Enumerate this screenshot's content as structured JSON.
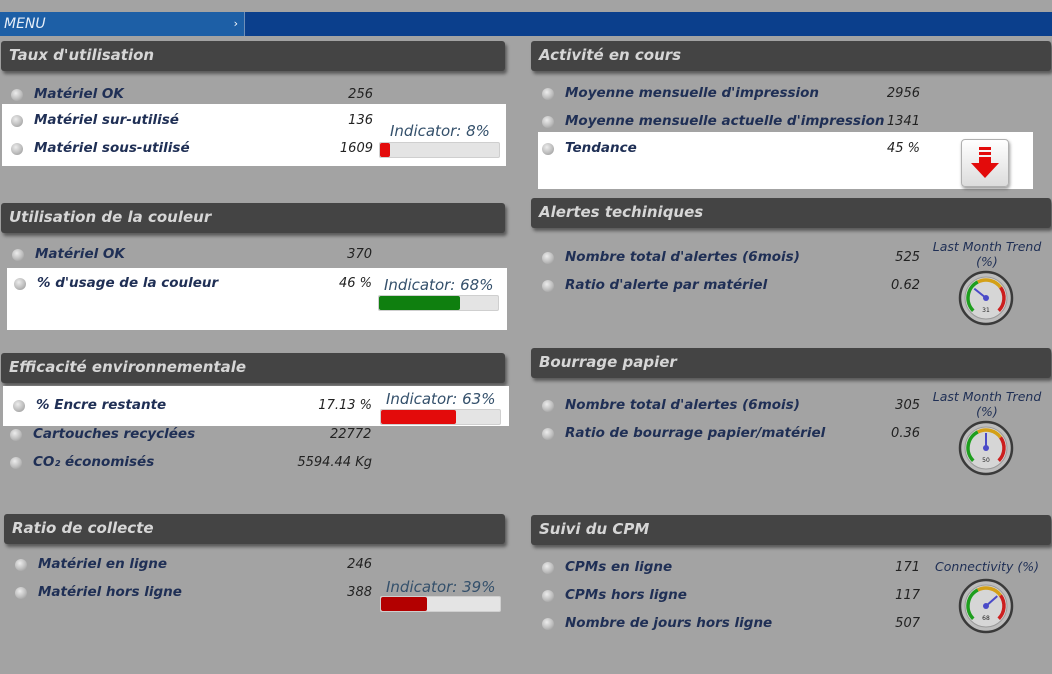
{
  "menu": {
    "label": "MENU"
  },
  "colors": {
    "red": "#e30b0b",
    "green": "#0f7f0f",
    "dark_red": "#b30000",
    "header_bg": "#444444"
  },
  "left": {
    "taux": {
      "title": "Taux d'utilisation",
      "rows": [
        {
          "label": "Matériel OK",
          "value": "256"
        },
        {
          "label": "Matériel sur-utilisé",
          "value": "136"
        },
        {
          "label": "Matériel sous-utilisé",
          "value": "1609"
        }
      ],
      "indicator": {
        "text": "Indicator: 8%",
        "level": 0.08
      }
    },
    "couleur": {
      "title": "Utilisation de la couleur",
      "rows": [
        {
          "label": "Matériel OK",
          "value": "370"
        },
        {
          "label": "% d'usage de la couleur",
          "value": "46 %"
        }
      ],
      "indicator": {
        "text": "Indicator: 68%",
        "level": 0.68
      }
    },
    "env": {
      "title": "Efficacité environnementale",
      "rows": [
        {
          "label": "% Encre restante",
          "value": "17.13 %"
        },
        {
          "label": "Cartouches recyclées",
          "value": "22772"
        },
        {
          "label": "CO₂ économisés",
          "value": "5594.44 Kg"
        }
      ],
      "indicator": {
        "text": "Indicator: 63%",
        "level": 0.63
      }
    },
    "collecte": {
      "title": "Ratio de collecte",
      "rows": [
        {
          "label": "Matériel en ligne",
          "value": "246"
        },
        {
          "label": "Matériel hors ligne",
          "value": "388"
        }
      ],
      "indicator": {
        "text": "Indicator: 39%",
        "level": 0.39
      }
    }
  },
  "right": {
    "activite": {
      "title": "Activité en cours",
      "rows": [
        {
          "label": "Moyenne mensuelle d'impression",
          "value": "2956"
        },
        {
          "label": "Moyenne mensuelle actuelle d'impression",
          "value": "1341"
        },
        {
          "label": "Tendance",
          "value": "45 %"
        }
      ],
      "trend_icon": "red-down-arrow-icon"
    },
    "alertes": {
      "title": "Alertes techiniques",
      "rows": [
        {
          "label": "Nombre total d'alertes (6mois)",
          "value": "525"
        },
        {
          "label": "Ratio d'alerte par matériel",
          "value": "0.62"
        }
      ],
      "trend_title_1": "Last Month Trend",
      "trend_title_2": "(%)",
      "gauge_value": "31",
      "gauge_level": 0.31
    },
    "bourrage": {
      "title": "Bourrage papier",
      "rows": [
        {
          "label": "Nombre total d'alertes (6mois)",
          "value": "305"
        },
        {
          "label": "Ratio de bourrage papier/matériel",
          "value": "0.36"
        }
      ],
      "trend_title_1": "Last Month Trend",
      "trend_title_2": "(%)",
      "gauge_value": "50",
      "gauge_level": 0.5
    },
    "cpm": {
      "title": "Suivi du CPM",
      "rows": [
        {
          "label": "CPMs en ligne",
          "value": "171"
        },
        {
          "label": "CPMs hors ligne",
          "value": "117"
        },
        {
          "label": "Nombre de jours hors ligne",
          "value": "507"
        }
      ],
      "trend_title_1": "Connectivity (%)",
      "gauge_value": "68",
      "gauge_level": 0.68
    }
  }
}
